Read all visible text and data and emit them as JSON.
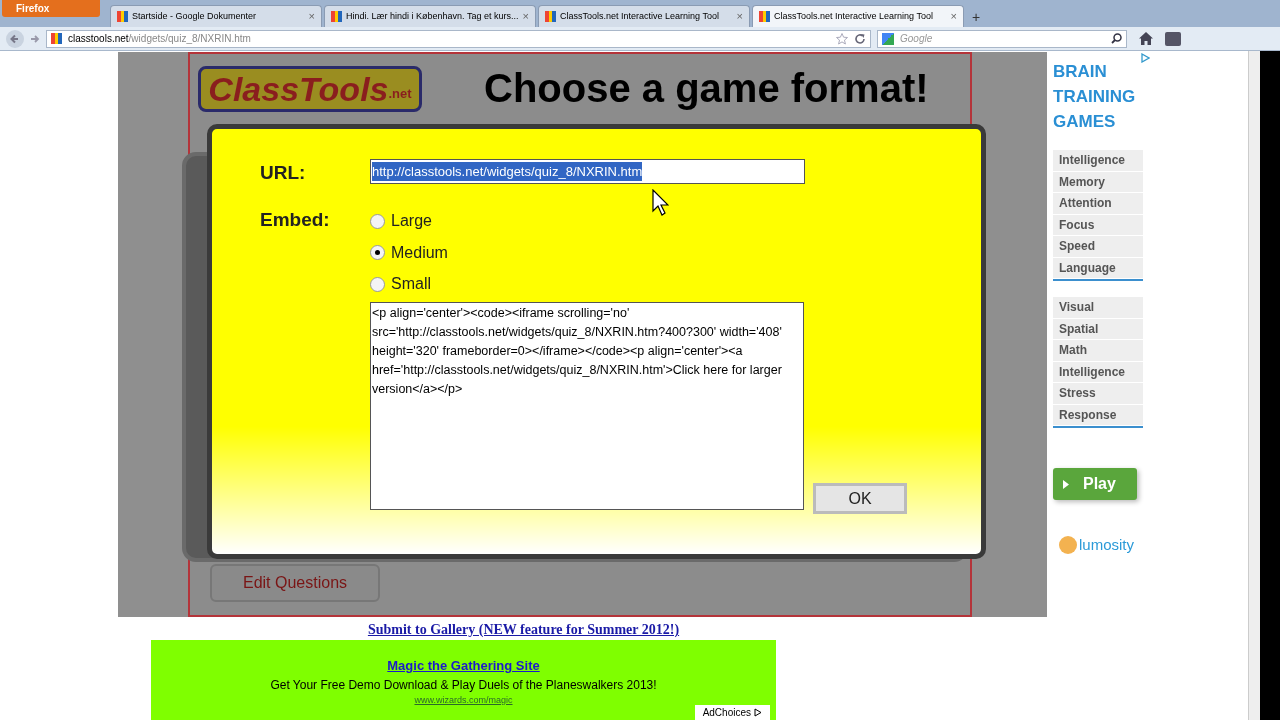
{
  "browser": {
    "menu_button": "Firefox",
    "tabs": [
      {
        "label": "Startside - Google Dokumenter",
        "selected": false,
        "close": "×"
      },
      {
        "label": "Hindi. Lær hindi i København. Tag et kurs...",
        "selected": false,
        "close": "×"
      },
      {
        "label": "ClassTools.net Interactive Learning Tool",
        "selected": false,
        "close": "×"
      },
      {
        "label": "ClassTools.net Interactive Learning Tool",
        "selected": true,
        "close": "×"
      }
    ],
    "new_tab": "+",
    "address_domain": "classtools.net",
    "address_path": "/widgets/quiz_8/NXRIN.htm",
    "search_placeholder": "Google"
  },
  "page": {
    "logo_main": "ClassTools",
    "logo_suffix": ".net",
    "heading": "Choose a game format!",
    "edit_button": "Edit Questions"
  },
  "dialog": {
    "url_label": "URL:",
    "url_value": "http://classtools.net/widgets/quiz_8/NXRIN.htm",
    "url_selected": true,
    "embed_label": "Embed:",
    "options": [
      {
        "label": "Large",
        "selected": false
      },
      {
        "label": "Medium",
        "selected": true
      },
      {
        "label": "Small",
        "selected": false
      }
    ],
    "embed_code": "<p align='center'><code><iframe scrolling='no' src='http://classtools.net/widgets/quiz_8/NXRIN.htm?400?300' width='408' height='320' frameborder=0></iframe></code><p align='center'><a href='http://classtools.net/widgets/quiz_8/NXRIN.htm'>Click here for larger version</a></p>",
    "ok": "OK"
  },
  "side_ad": {
    "title": "BRAIN TRAINING GAMES",
    "groups": [
      [
        "Intelligence",
        "Memory",
        "Attention",
        "Focus",
        "Speed",
        "Language"
      ],
      [
        "Visual",
        "Spatial",
        "Math",
        "Intelligence",
        "Stress",
        "Response"
      ]
    ],
    "play": "Play",
    "brand": "lumosity"
  },
  "footer": {
    "submit_link": "Submit to Gallery (NEW feature for Summer 2012!)",
    "ad_title": "Magic the Gathering Site",
    "ad_text": "Get Your Free Demo Download & Play Duels of the Planeswalkers 2013!",
    "ad_url": "www.wizards.com/magic",
    "ad_choices": "AdChoices"
  }
}
